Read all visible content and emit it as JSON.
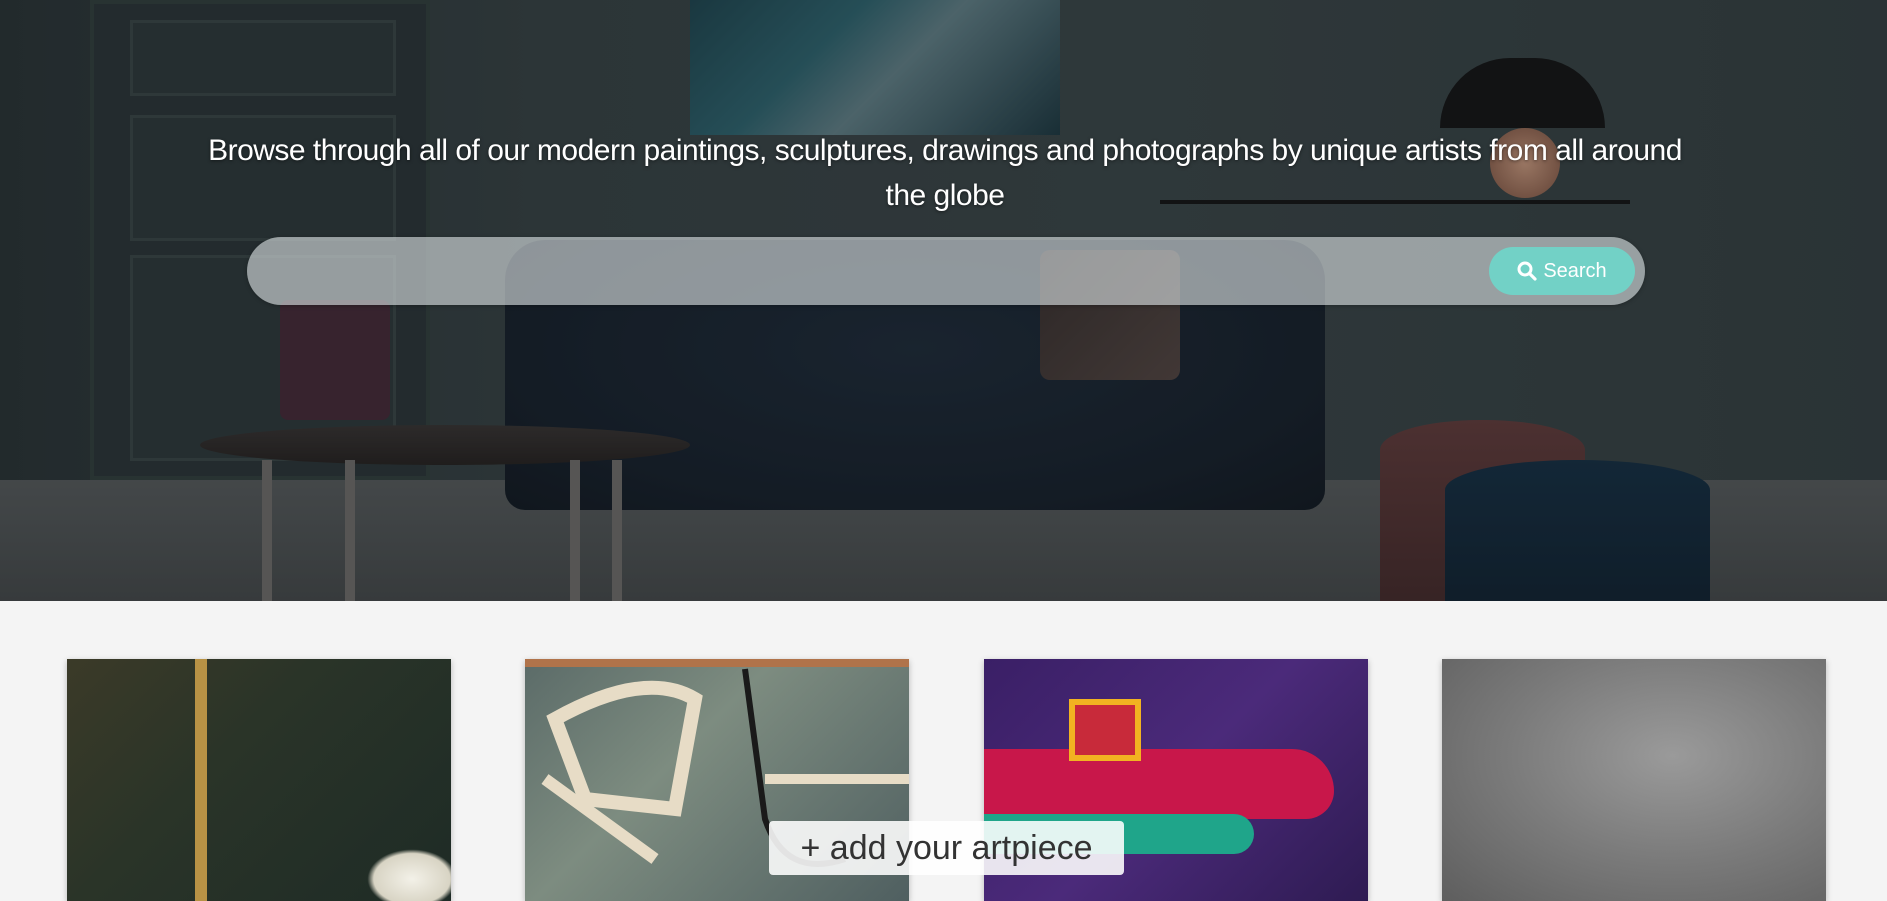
{
  "hero": {
    "title": "Browse through all of our modern paintings, sculptures, drawings and photographs by unique artists from all around the globe"
  },
  "search": {
    "placeholder": "",
    "value": "",
    "button_label": "Search",
    "button_icon": "search-icon"
  },
  "gallery": {
    "items": [
      {
        "name": "artwork-1"
      },
      {
        "name": "artwork-2"
      },
      {
        "name": "artwork-3"
      },
      {
        "name": "artwork-4"
      }
    ]
  },
  "add_artpiece": {
    "label": "+ add your artpiece"
  },
  "colors": {
    "accent": "#72d1c6",
    "background": "#f4f4f4"
  }
}
